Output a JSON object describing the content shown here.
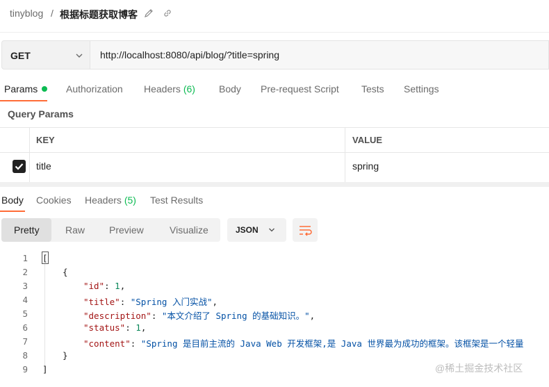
{
  "header": {
    "collection": "tinyblog",
    "separator": "/",
    "request_name": "根据标题获取博客"
  },
  "request": {
    "method": "GET",
    "url": "http://localhost:8080/api/blog/?title=spring"
  },
  "request_tabs": {
    "params": "Params",
    "authorization": "Authorization",
    "headers": "Headers",
    "headers_count": "(6)",
    "body": "Body",
    "prerequest": "Pre-request Script",
    "tests": "Tests",
    "settings": "Settings"
  },
  "query_params": {
    "title": "Query Params",
    "key_header": "KEY",
    "value_header": "VALUE",
    "rows": [
      {
        "key": "title",
        "value": "spring",
        "checked": true
      }
    ]
  },
  "response_tabs": {
    "body": "Body",
    "cookies": "Cookies",
    "headers": "Headers",
    "headers_count": "(5)",
    "test_results": "Test Results"
  },
  "view_modes": {
    "pretty": "Pretty",
    "raw": "Raw",
    "preview": "Preview",
    "visualize": "Visualize",
    "format": "JSON"
  },
  "code": {
    "line_numbers": [
      "1",
      "2",
      "3",
      "4",
      "5",
      "6",
      "7",
      "8",
      "9"
    ],
    "open_bracket": "[",
    "open_brace": "{",
    "close_brace": "}",
    "close_bracket": "]",
    "fields": [
      {
        "key": "\"id\"",
        "value": "1",
        "type": "number"
      },
      {
        "key": "\"title\"",
        "value": "\"Spring 入门实战\"",
        "type": "string"
      },
      {
        "key": "\"description\"",
        "value": "\"本文介绍了 Spring 的基础知识。\"",
        "type": "string"
      },
      {
        "key": "\"status\"",
        "value": "1",
        "type": "number"
      },
      {
        "key": "\"content\"",
        "value": "\"Spring 是目前主流的 Java Web 开发框架,是 Java 世界最为成功的框架。该框架是一个轻量",
        "type": "string"
      }
    ]
  },
  "watermark": "@稀土掘金技术社区",
  "colors": {
    "accent": "#ff6c37",
    "success": "#0cbb52",
    "json_key": "#a31515",
    "json_string": "#0451a5",
    "json_number": "#098658"
  }
}
